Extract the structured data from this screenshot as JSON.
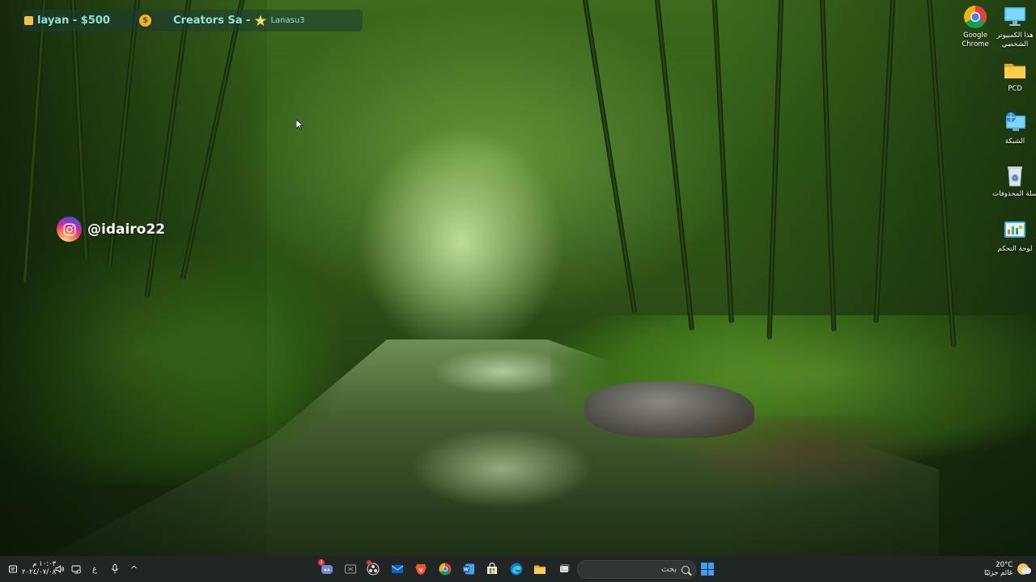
{
  "overlay": {
    "banner": {
      "donor_text": "layan - $500",
      "creators_text": "Creators Sa -",
      "name_text": "Lanasu3"
    },
    "instagram_handle": "@idairo22"
  },
  "desktop_icons": [
    {
      "name": "google-chrome",
      "label": "Google Chrome",
      "icon": "chrome-icon"
    },
    {
      "name": "this-pc",
      "label": "هذا الكمبيوتر الشخصي",
      "icon": "monitor-icon"
    },
    {
      "name": "pcd-folder",
      "label": "PCD",
      "icon": "folder-icon"
    },
    {
      "name": "network",
      "label": "الشبكة",
      "icon": "network-icon"
    },
    {
      "name": "recycle-bin",
      "label": "سلة المحذوفات",
      "icon": "recycle-bin-icon"
    },
    {
      "name": "control-panel",
      "label": "لوحة التحكم",
      "icon": "control-panel-icon"
    }
  ],
  "taskbar": {
    "weather_temp": "20°C",
    "weather_desc": "غائم جزئيًا",
    "search_placeholder": "بحث",
    "clock_time": "١٠:٠٣ م",
    "clock_date": "٢٠٢٤/٠٧/٠٨",
    "language": "ع",
    "discord_badge": "1",
    "apps": [
      "start-button",
      "file-explorer-icon",
      "microsoft-store-icon",
      "edge-icon",
      "store-bag-icon",
      "word-icon",
      "chrome-icon",
      "brave-icon",
      "mail-icon",
      "obs-icon",
      "xbox-icon",
      "discord-icon"
    ]
  },
  "colors": {
    "taskbar_bg": "#1f2624",
    "banner_text": "#8fe3d6",
    "windows_blue": "#3aa0f3"
  }
}
